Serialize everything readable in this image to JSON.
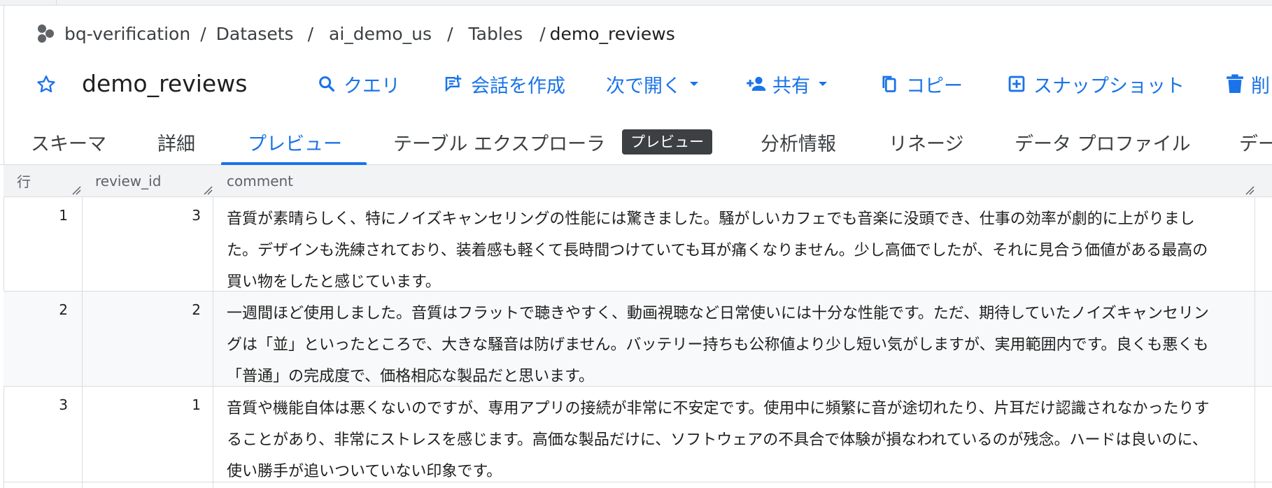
{
  "breadcrumb": {
    "project": "bq-verification",
    "items": [
      "Datasets",
      "ai_demo_us",
      "Tables",
      "demo_reviews"
    ],
    "separator": "/"
  },
  "title": "demo_reviews",
  "actions": {
    "query": "クエリ",
    "conversation": "会話を作成",
    "open_in": "次で開く",
    "share": "共有",
    "copy": "コピー",
    "snapshot": "スナップショット",
    "delete": "削"
  },
  "tabs": {
    "schema": "スキーマ",
    "details": "詳細",
    "preview": "プレビュー",
    "explorer": "テーブル エクスプローラ",
    "explorer_badge": "プレビュー",
    "insights": "分析情報",
    "lineage": "リネージ",
    "profile": "データ プロファイル",
    "more": "デー"
  },
  "table": {
    "headers": {
      "row": "行",
      "review_id": "review_id",
      "comment": "comment"
    },
    "rows": [
      {
        "row": "1",
        "review_id": "3",
        "comment": "音質が素晴らしく、特にノイズキャンセリングの性能には驚きました。騒がしいカフェでも音楽に没頭でき、仕事の効率が劇的に上がりました。デザインも洗練されており、装着感も軽くて長時間つけていても耳が痛くなりません。少し高価でしたが、それに見合う価値がある最高の買い物をしたと感じています。"
      },
      {
        "row": "2",
        "review_id": "2",
        "comment": "一週間ほど使用しました。音質はフラットで聴きやすく、動画視聴など日常使いには十分な性能です。ただ、期待していたノイズキャンセリングは「並」といったところで、大きな騒音は防げません。バッテリー持ちも公称値より少し短い気がしますが、実用範囲内です。良くも悪くも「普通」の完成度で、価格相応な製品だと思います。"
      },
      {
        "row": "3",
        "review_id": "1",
        "comment": "音質や機能自体は悪くないのですが、専用アプリの接続が非常に不安定です。使用中に頻繁に音が途切れたり、片耳だけ認識されなかったりすることがあり、非常にストレスを感じます。高価な製品だけに、ソフトウェアの不具合で体験が損なわれているのが残念。ハードは良いのに、使い勝手が追いついていない印象です。"
      }
    ]
  },
  "colors": {
    "accent": "#1a73e8",
    "text": "#1f1f1f",
    "muted": "#5f6368",
    "border": "#dadce0",
    "header_bg": "#f1f3f4",
    "badge_bg": "#3c4043"
  },
  "icons": {
    "project": "bigquery-project-icon",
    "star": "star-outline-icon",
    "query": "search-icon",
    "conversation": "chat-add-icon",
    "open_in": "chevron-down-icon",
    "share": "person-add-icon",
    "copy": "copy-icon",
    "snapshot": "snapshot-icon",
    "delete": "trash-icon"
  }
}
